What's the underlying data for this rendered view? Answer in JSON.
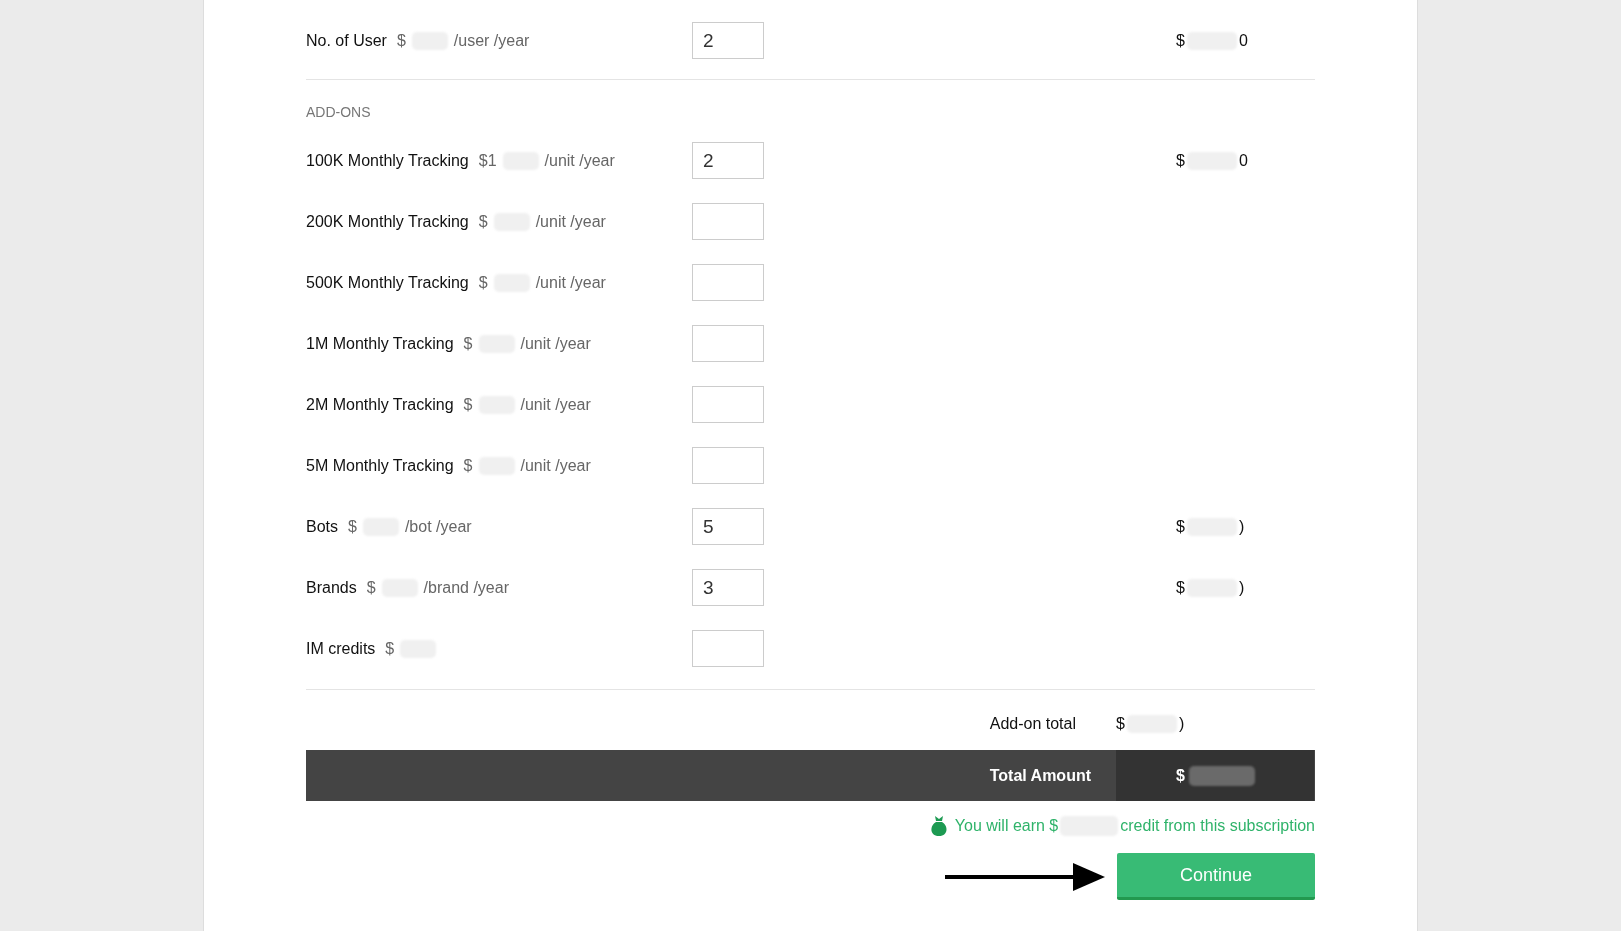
{
  "base": {
    "label": "No. of User",
    "price_prefix": "$",
    "unit": "/user /year",
    "quantity": "2",
    "amount_prefix": "$",
    "amount_suffix": "0"
  },
  "section_title": "ADD-ONS",
  "addons": [
    {
      "label": "100K Monthly Tracking",
      "price_prefix": "$1",
      "unit": "/unit /year",
      "quantity": "2",
      "amount_prefix": "$",
      "amount_suffix": "0"
    },
    {
      "label": "200K Monthly Tracking",
      "price_prefix": "$",
      "unit": "/unit /year"
    },
    {
      "label": "500K Monthly Tracking",
      "price_prefix": "$",
      "unit": "/unit /year"
    },
    {
      "label": "1M Monthly Tracking",
      "price_prefix": "$",
      "unit": "/unit /year"
    },
    {
      "label": "2M Monthly Tracking",
      "price_prefix": "$",
      "unit": "/unit /year"
    },
    {
      "label": "5M Monthly Tracking",
      "price_prefix": "$",
      "unit": "/unit /year"
    },
    {
      "label": "Bots",
      "price_prefix": "$",
      "unit": "/bot /year",
      "quantity": "5",
      "amount_prefix": "$",
      "amount_suffix": ")"
    },
    {
      "label": "Brands",
      "price_prefix": "$",
      "unit": "/brand /year",
      "quantity": "3",
      "amount_prefix": "$",
      "amount_suffix": ")"
    },
    {
      "label": "IM credits",
      "price_prefix": "$"
    }
  ],
  "addon_total": {
    "label": "Add-on total",
    "amount_prefix": "$",
    "amount_suffix": ")"
  },
  "total": {
    "label": "Total Amount",
    "amount_prefix": "$"
  },
  "credit_note": {
    "before": "You will earn $",
    "after": "credit from this subscription"
  },
  "continue_button": "Continue"
}
